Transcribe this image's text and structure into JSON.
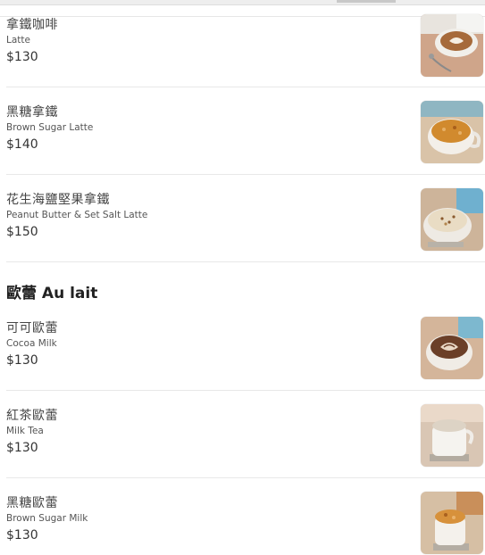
{
  "section_title": "歐蕾 Au lait",
  "items": [
    {
      "zh": "拿鐵咖啡",
      "en": "Latte",
      "price": "$130",
      "photo_icon": "latte-art-photo"
    },
    {
      "zh": "黑糖拿鐵",
      "en": "Brown Sugar Latte",
      "price": "$140",
      "photo_icon": "brown-sugar-latte-photo"
    },
    {
      "zh": "花生海鹽堅果拿鐵",
      "en": "Peanut Butter & Set Salt Latte",
      "price": "$150",
      "photo_icon": "peanut-salt-latte-photo"
    },
    {
      "zh": "可可歐蕾",
      "en": "Cocoa Milk",
      "price": "$130",
      "photo_icon": "cocoa-milk-photo"
    },
    {
      "zh": "紅茶歐蕾",
      "en": "Milk Tea",
      "price": "$130",
      "photo_icon": "milk-tea-photo"
    },
    {
      "zh": "黑糖歐蕾",
      "en": "Brown Sugar Milk",
      "price": "$130",
      "photo_icon": "brown-sugar-milk-photo"
    }
  ]
}
